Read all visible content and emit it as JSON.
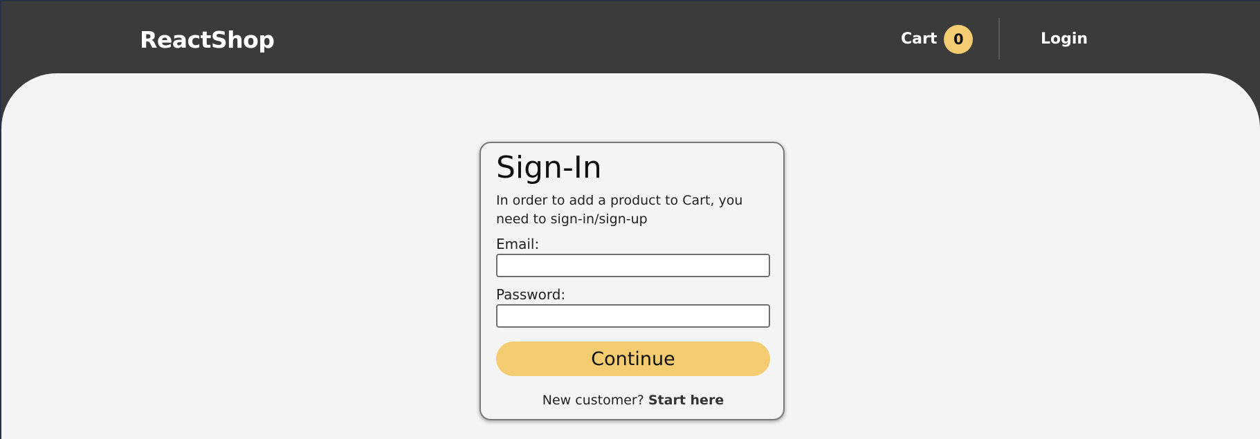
{
  "navbar": {
    "brand": "ReactShop",
    "cart_label": "Cart",
    "cart_count": "0",
    "login_label": "Login"
  },
  "signin": {
    "title": "Sign-In",
    "description": "In order to add a product to Cart, you need to sign-in/sign-up",
    "email_label": "Email:",
    "email_value": "",
    "password_label": "Password:",
    "password_value": "",
    "continue_label": "Continue",
    "new_customer_text": "New customer?",
    "start_here_label": "Start here"
  },
  "colors": {
    "navbar_bg": "#3b3b3b",
    "content_bg": "#f4f4f4",
    "accent": "#f3cc72",
    "text": "#222222",
    "nav_text": "#ffffff"
  }
}
